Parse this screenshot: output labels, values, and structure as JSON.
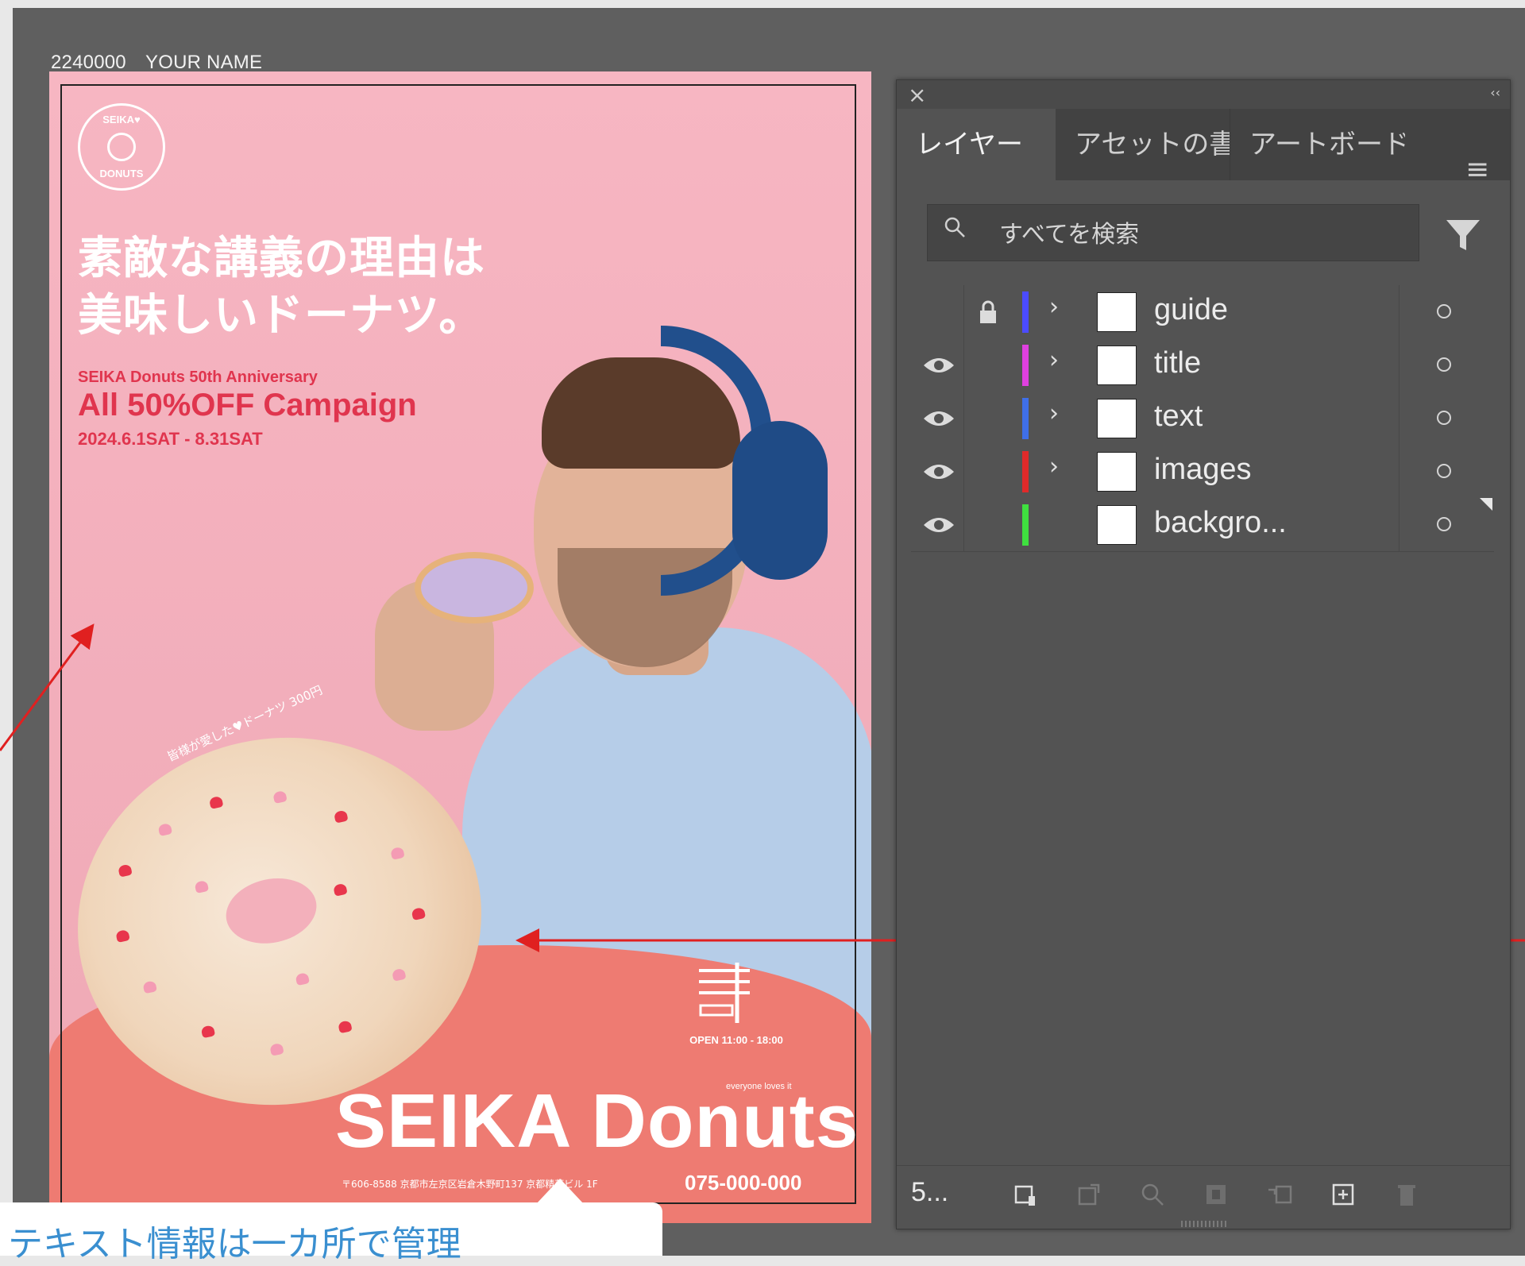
{
  "artboard": {
    "label": "2240000　YOUR NAME"
  },
  "poster": {
    "logo_top": "SEIKA♥",
    "logo_bottom": "DONUTS",
    "headline_line1": "素敵な講義の理由は",
    "headline_line2": "美味しいドーナツ。",
    "anniversary": "SEIKA Donuts 50th Anniversary",
    "campaign": "All 50%OFF Campaign",
    "dates": "2024.6.1SAT - 8.31SAT",
    "curved_caption": "皆様が愛した♥ドーナツ 300円",
    "open_hours": "OPEN 11:00 - 18:00",
    "tagline": "everyone loves it",
    "brand": "SEIKA Donuts",
    "address": "〒606-8588 京都市左京区岩倉木野町137 京都精華ビル 1F",
    "phone": "075-000-000",
    "colors": {
      "pink": "#f4b1bd",
      "coral": "#ee7b72",
      "red_text": "#e0354e"
    }
  },
  "annotation": {
    "callout_text": "テキスト情報は一カ所で管理",
    "arrow_color": "#e02020"
  },
  "layers_panel": {
    "close_icon": "close-icon",
    "collapse_icon": "collapse-icon",
    "tabs": [
      {
        "label": "レイヤー",
        "active": true
      },
      {
        "label": "アセットの書き出し",
        "active": false
      },
      {
        "label": "アートボード",
        "active": false
      }
    ],
    "search_placeholder": "すべてを検索",
    "layers": [
      {
        "name": "guide",
        "visible": false,
        "locked": true,
        "color": "#4b4bff",
        "expandable": true
      },
      {
        "name": "title",
        "visible": true,
        "locked": false,
        "color": "#e040e0",
        "expandable": true
      },
      {
        "name": "text",
        "visible": true,
        "locked": false,
        "color": "#3f6fe8",
        "expandable": true
      },
      {
        "name": "images",
        "visible": true,
        "locked": false,
        "color": "#e02a2a",
        "expandable": true
      },
      {
        "name": "backgro...",
        "visible": true,
        "locked": false,
        "color": "#3fe03f",
        "expandable": false
      }
    ],
    "footer": {
      "layer_count": "5...",
      "buttons": [
        "collect-for-export-icon",
        "export-icon",
        "locate-object-icon",
        "make-clipping-mask-icon",
        "create-sublayer-icon",
        "create-layer-icon",
        "delete-icon"
      ]
    }
  }
}
